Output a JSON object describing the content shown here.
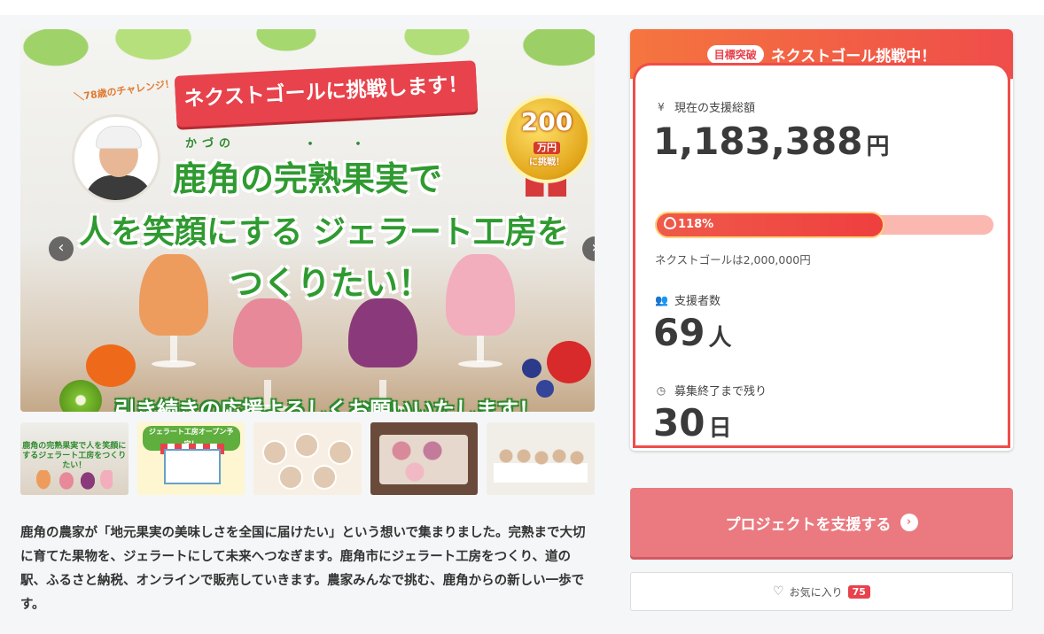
{
  "hero": {
    "challenge_caption": "＼78歳のチャレンジ！／",
    "ribbon": "ネクストゴールに挑戦します！",
    "badge_amount": "200",
    "badge_unit": "万円",
    "badge_sub": "に挑戦！",
    "furigana": "かづの",
    "title_line1": "鹿角の完熟果実で",
    "title_line2": "人を笑顔にする ジェラート工房を",
    "title_line3": "つくりたい！",
    "bottom_banner": "引き続きの応援よろしくお願いいたします！",
    "prev_icon": "chevron-left-icon",
    "next_icon": "chevron-right-icon"
  },
  "thumbnails": {
    "t1_caption": "鹿角の完熟果実で人を笑顔にするジェラート工房をつくりたい！",
    "t2_caption": "ジェラート工房オープン予定！"
  },
  "description": "鹿角の農家が「地元果実の美味しさを全国に届けたい」という想いで集まりました。完熟まで大切に育てた果物を、ジェラートにして未来へつなぎます。鹿角市にジェラート工房をつくり、道の駅、ふるさと納税、オンラインで販売していきます。農家みんなで挑む、鹿角からの新しい一歩です。",
  "status": {
    "goal_tag": "目標突破",
    "header_title": "ネクストゴール挑戦中！",
    "total_label": "現在の支援総額",
    "total_icon": "yen-icon",
    "total_value": "1,183,388",
    "total_unit": "円",
    "progress_percent": "118%",
    "progress_ratio": 1.18,
    "next_goal": "ネクストゴールは2,000,000円",
    "supporters_label": "支援者数",
    "supporters_icon": "users-icon",
    "supporters_value": "69",
    "supporters_unit": "人",
    "remaining_label": "募集終了まで残り",
    "remaining_icon": "clock-icon",
    "remaining_value": "30",
    "remaining_unit": "日"
  },
  "actions": {
    "support_label": "プロジェクトを支援する",
    "favorite_label": "お気に入り",
    "favorite_count": "75"
  },
  "colors": {
    "accent": "#ef4d4a",
    "button": "#ea7a80",
    "title_green": "#2f9a30"
  }
}
